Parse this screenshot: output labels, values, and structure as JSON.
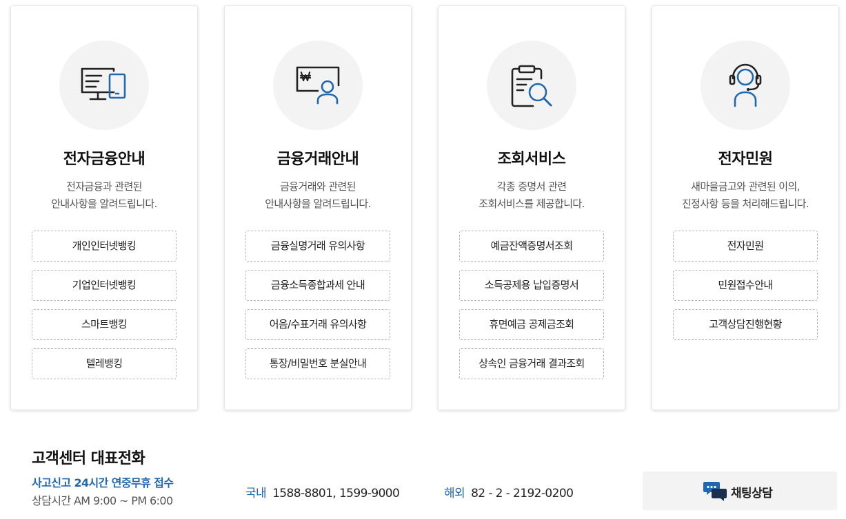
{
  "colors": {
    "accent": "#1f67b1",
    "icon_dark": "#222222",
    "circle_bg": "#f3f3f3"
  },
  "cards": [
    {
      "icon": "monitor-tablet-icon",
      "title": "전자금융안내",
      "desc": [
        "전자금융과 관련된",
        "안내사항을 알려드립니다."
      ],
      "buttons": [
        "개인인터넷뱅킹",
        "기업인터넷뱅킹",
        "스마트뱅킹",
        "텔레뱅킹"
      ]
    },
    {
      "icon": "won-person-board-icon",
      "title": "금융거래안내",
      "desc": [
        "금융거래와 관련된",
        "안내사항을 알려드립니다."
      ],
      "buttons": [
        "금융실명거래 유의사항",
        "금융소득종합과세 안내",
        "어음/수표거래 유의사항",
        "통장/비밀번호 분실안내"
      ]
    },
    {
      "icon": "clipboard-search-icon",
      "title": "조회서비스",
      "desc": [
        "각종 증명서 관련",
        "조회서비스를 제공합니다."
      ],
      "buttons": [
        "예금잔액증명서조회",
        "소득공제용 납입증명서",
        "휴면예금 공제금조회",
        "상속인 금융거래 결과조회"
      ]
    },
    {
      "icon": "headset-agent-icon",
      "title": "전자민원",
      "desc": [
        "새마을금고와 관련된 이의,",
        "진정사항 등을 처리해드립니다."
      ],
      "buttons": [
        "전자민원",
        "민원접수안내",
        "고객상담진행현황"
      ]
    }
  ],
  "footer": {
    "title": "고객센터 대표전화",
    "notice": "사고신고 24시간 연중무휴 접수",
    "hours": "상담시간 AM 9:00 ~ PM 6:00",
    "domestic_label": "국내",
    "domestic_number": "1588-8801, 1599-9000",
    "overseas_label": "해외",
    "overseas_number": "82 - 2 - 2192-0200",
    "chat_icon": "chat-bubbles-icon",
    "chat_label": "채팅상담"
  }
}
